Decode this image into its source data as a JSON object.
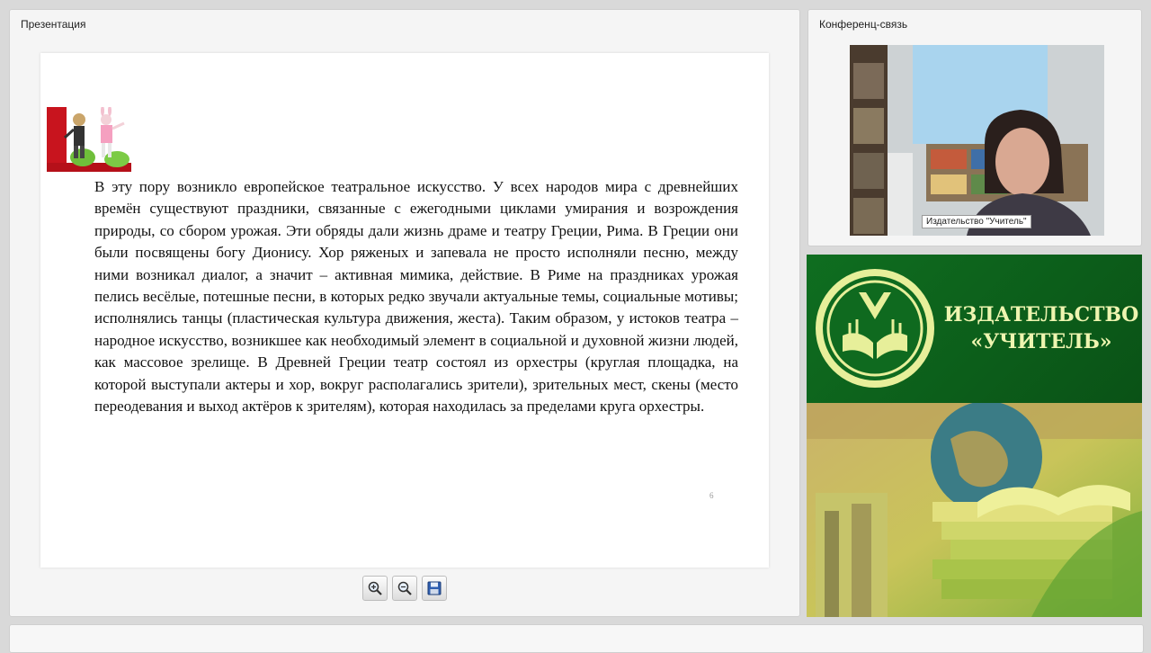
{
  "presentation": {
    "title": "Презентация",
    "slide": {
      "text": "В эту пору возникло европейское театральное искусство. У всех народов мира с древнейших времён существуют праздники, связанные с ежегодными циклами умирания и возрождения природы, со сбором урожая. Эти обряды дали жизнь драме и театру Греции, Рима. В Греции они были посвящены богу Дионису. Хор ряженых и запевала не просто исполняли песню, между ними возникал диалог, а значит – активная мимика, действие. В Риме на праздниках урожая пелись весёлые, потешные песни, в которых редко звучали актуальные темы, социальные мотивы; исполнялись танцы (пластическая культура движения, жеста). Таким образом, у истоков театра – народное искусство, возникшее как необходимый элемент в социальной и духовной жизни людей, как массовое зрелище. В Древней Греции театр состоял из орхестры (круглая площадка, на которой выступали актеры и хор, вокруг располагались зрители), зрительных мест, скены (место переодевания и выход актёров к зрителям), которая находилась за пределами круга орхестры.",
      "page_number": "6"
    },
    "toolbar": {
      "zoom_in_icon": "zoom-in-icon",
      "zoom_out_icon": "zoom-out-icon",
      "save_icon": "save-icon"
    }
  },
  "conference": {
    "title": "Конференц-связь",
    "video_label": "Издательство \"Учитель\""
  },
  "banner": {
    "line1": "ИЗДАТЕЛЬСТВО",
    "line2": "«УЧИТЕЛЬ»",
    "colors": {
      "green": "#0d5a1a",
      "text": "#eef5b0"
    }
  }
}
